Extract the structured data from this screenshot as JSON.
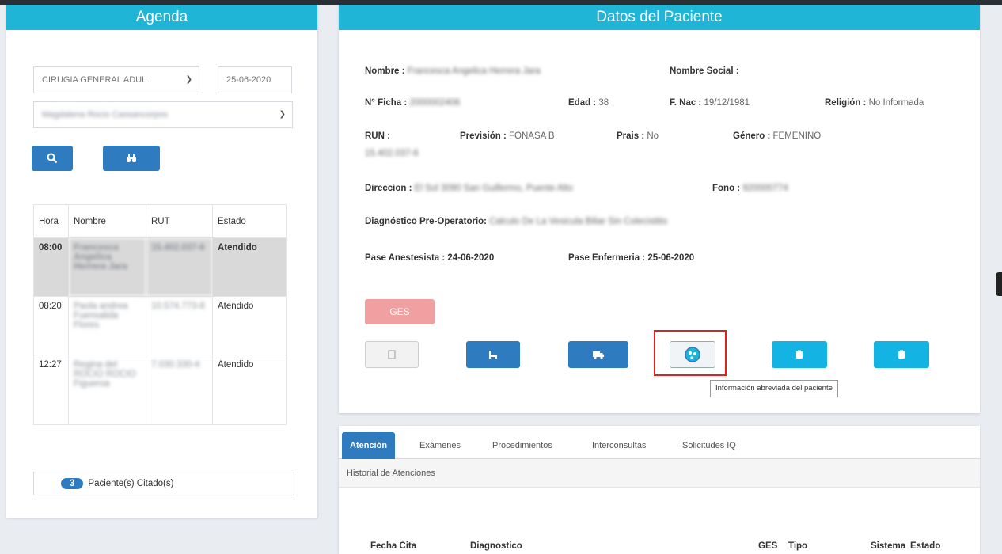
{
  "agenda": {
    "title": "Agenda",
    "specialty": "CIRUGIA GENERAL ADUL",
    "date": "25-06-2020",
    "doctor": "Magdalena Rocio Cassancorpos",
    "search_icon": "search-icon",
    "binoculars_icon": "binoculars-icon",
    "columns": [
      "Hora",
      "Nombre",
      "RUT",
      "Estado"
    ],
    "rows": [
      {
        "hora": "08:00",
        "nombre": "Francesca Angelica Herrera Jara",
        "rut": "15.402.037-6",
        "estado": "Atendido"
      },
      {
        "hora": "08:20",
        "nombre": "Paola andrea Fuensalida Flores",
        "rut": "10.574.773-8",
        "estado": "Atendido"
      },
      {
        "hora": "12:27",
        "nombre": "Regina del ROCIO ROCIO Figueroa",
        "rut": "7.030.330-4",
        "estado": "Atendido"
      }
    ],
    "count": "3",
    "count_label": "Paciente(s) Citado(s)"
  },
  "paciente": {
    "title": "Datos del Paciente",
    "nombre_label": "Nombre :",
    "nombre_value": "Francesca Angelica Herrera Jara",
    "nombre_social_label": "Nombre Social :",
    "ficha_label": "N° Ficha :",
    "ficha_value": "2000002406",
    "edad_label": "Edad :",
    "edad_value": "38",
    "fnac_label": "F. Nac :",
    "fnac_value": "19/12/1981",
    "religion_label": "Religión :",
    "religion_value": "No Informada",
    "run_label": "RUN :",
    "run_value": "15.402.037-6",
    "prevision_label": "Previsión :",
    "prevision_value": "FONASA B",
    "prais_label": "Prais :",
    "prais_value": "No",
    "genero_label": "Género :",
    "genero_value": "FEMENINO",
    "direccion_label": "Direccion :",
    "direccion_value": "El Sol 3090 San Guillermo, Puente Alto",
    "fono_label": "Fono :",
    "fono_value": "920000774",
    "diag_label": "Diagnóstico Pre-Operatorio:",
    "diag_value": "Calculo De La Vesicula Biliar Sin Colecistitis",
    "pase_anest": "Pase Anestesista : 24-06-2020",
    "pase_enf": "Pase Enfermeria : 25-06-2020",
    "ges_label": "GES",
    "tooltip": "Información abreviada del paciente"
  },
  "tabs": {
    "items": [
      "Atención",
      "Exámenes",
      "Procedimientos",
      "Interconsultas",
      "Solicitudes IQ"
    ],
    "history_label": "Historial de Atenciones",
    "columns": [
      "Fecha Cita",
      "Diagnostico",
      "GES",
      "Tipo",
      "Sistema",
      "Estado"
    ]
  },
  "colors": {
    "header": "#1fb5d6",
    "primary": "#2e7bbf",
    "ges": "#f0a0a0",
    "highlight": "#e02020"
  }
}
